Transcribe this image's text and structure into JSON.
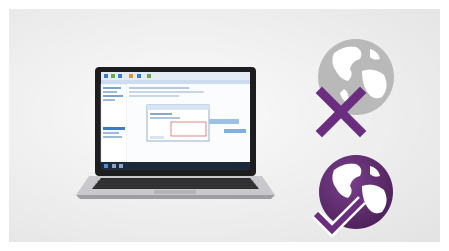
{
  "colors": {
    "panel_background": "#eeeeee",
    "globe_offline": "#b9b9b9",
    "globe_online": "#5d2a6d",
    "accent_purple": "#6b2d80",
    "check_white": "#ffffff",
    "laptop_body": "#c8c8cc",
    "laptop_keys": "#2c2c2e",
    "screen_blue": "#d7e6f7"
  },
  "icons": {
    "offline": "globe-with-x-icon",
    "online": "globe-with-checkmark-icon",
    "device": "laptop-icon"
  }
}
